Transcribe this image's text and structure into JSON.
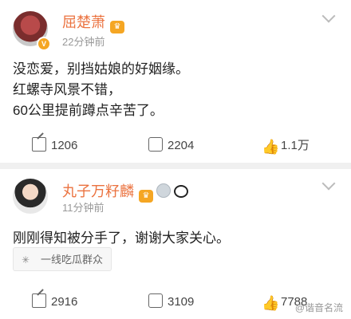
{
  "posts": [
    {
      "name": "屈楚萧",
      "time": "22分钟前",
      "content_lines": [
        "没恋爱，别挡姑娘的好姻缘。",
        "红螺寺风景不错，",
        "60公里提前蹲点辛苦了。"
      ],
      "shares": "1206",
      "comments": "2204",
      "likes": "1.1万"
    },
    {
      "name": "丸子万籽麟",
      "time": "11分钟前",
      "content_lines": [
        "刚刚得知被分手了，谢谢大家关心。"
      ],
      "topic": "一线吃瓜群众",
      "shares": "2916",
      "comments": "3109",
      "likes": "7788"
    }
  ],
  "watermark": "@谐音名流",
  "colors": {
    "name": "#eb7340",
    "badge": "#f5a623",
    "text": "#222222",
    "meta": "#999999"
  },
  "icons": [
    "verified-badge-icon",
    "vip-crown-icon",
    "chevron-down-icon",
    "share-icon",
    "comment-icon",
    "like-icon",
    "topic-icon",
    "panda-icon",
    "ring-badge-icon"
  ]
}
